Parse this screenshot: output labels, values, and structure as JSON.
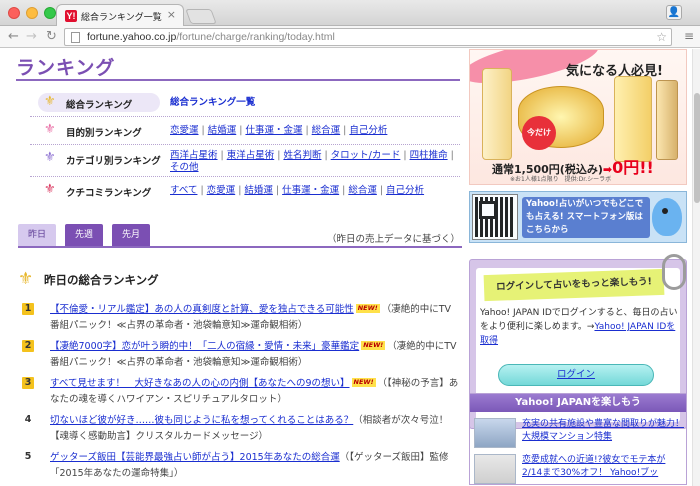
{
  "browser": {
    "tab_title": "総合ランキング一覧",
    "tab_favicon": "Y!",
    "url_host": "fortune.yahoo.co.jp",
    "url_path": "/fortune/charge/ranking/today.html"
  },
  "page": {
    "heading": "ランキング",
    "menu": [
      {
        "label": "総合ランキング",
        "icon": "fleur-icon",
        "color": "#e7b62a",
        "links": [
          "総合ランキング一覧"
        ],
        "selected": true
      },
      {
        "label": "目的別ランキング",
        "icon": "fleur-icon",
        "color": "#e86aa2",
        "links": [
          "恋愛運",
          "結婚運",
          "仕事運・金運",
          "総合運",
          "自己分析"
        ]
      },
      {
        "label": "カテゴリ別ランキング",
        "icon": "fleur-icon",
        "color": "#8a6dd0",
        "links": [
          "西洋占星術",
          "東洋占星術",
          "姓名判断",
          "タロット/カード",
          "四柱推命",
          "その他"
        ]
      },
      {
        "label": "クチコミランキング",
        "icon": "fleur-icon",
        "color": "#d9335c",
        "links": [
          "すべて",
          "恋愛運",
          "結婚運",
          "仕事運・金運",
          "総合運",
          "自己分析"
        ]
      }
    ],
    "period_tabs": [
      "昨日",
      "先週",
      "先月"
    ],
    "period_note": "（昨日の売上データに基づく）",
    "section_title": "昨日の総合ランキング",
    "new_badge": "NEW!",
    "rankings": [
      {
        "rank": "1",
        "title": "【不倫愛・リアル鑑定】あの人の真剣度と計算、愛を独占できる可能性",
        "new": true,
        "desc": "（凄絶的中にTV番組パニック！≪占界の革命者・池袋輪意知≫運命観相術）"
      },
      {
        "rank": "2",
        "title": "【凄絶7000字】恋が叶う瞬的中！「二人の宿縁・愛情・未来」豪華鑑定",
        "new": true,
        "desc": "（凄絶的中にTV番組パニック！≪占界の革命者・池袋輪意知≫運命観相術）"
      },
      {
        "rank": "3",
        "title": "すべて見せます！　大好きなあの人の心の内側【あなたへの9の想い】",
        "new": true,
        "desc": "（【神秘の予言】あなたの魂を導くハワイアン・スピリチュアルタロット）"
      },
      {
        "rank": "4",
        "title": "切ないほど彼が好き……彼も同じように私を想ってくれることはある？",
        "new": false,
        "desc": "（相談者が次々号泣！【魂導く感動助言】クリスタルカードメッセージ）"
      },
      {
        "rank": "5",
        "title": "ゲッターズ飯田【芸能界最強占い師が占う】2015年あなたの総合運",
        "new": false,
        "desc": "（【ゲッターズ飯田】監修「2015年あなたの運命特集」）"
      }
    ]
  },
  "sidebar": {
    "ad": {
      "headline": "気になる人必見!",
      "badge": "今だけ",
      "price_label": "通常1,500円(税込み)",
      "price_arrow": "➡",
      "price_now": "0円!!",
      "note": "※お1人様1点限り　提供:Dr.シーラボ"
    },
    "smartphone": {
      "text": "Yahoo!占いがいつでもどこでも占える! スマートフォン版はこちらから"
    },
    "login": {
      "banner": "ログインして占いをもっと楽しもう!",
      "body": "Yahoo! JAPAN IDでログインすると、毎日の占いをより便利に楽しめます。→",
      "link": "Yahoo! JAPAN IDを取得",
      "button": "ログイン"
    },
    "yj": {
      "heading": "Yahoo! JAPANを楽しもう",
      "items": [
        {
          "text": "充実の共有施設や豊富な間取りが魅力！大規模マンション特集"
        },
        {
          "text": "恋愛成就への近道!?彼女でモテ本が2/14まで30%オフ！ Yahoo!ブッ"
        }
      ]
    }
  }
}
